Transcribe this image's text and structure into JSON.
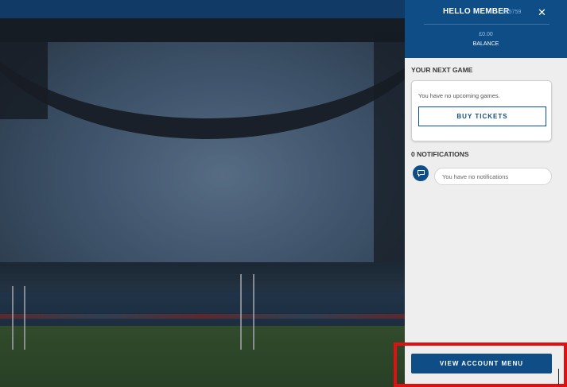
{
  "panel": {
    "greeting": "HELLO MEMBER",
    "member_id": "925759",
    "close_glyph": "✕",
    "balance_amount": "£0.00",
    "balance_label": "BALANCE",
    "next_game_title": "YOUR NEXT GAME",
    "no_games_text": "You have no upcoming games.",
    "buy_tickets_label": "BUY TICKETS",
    "notifications_title": "0 NOTIFICATIONS",
    "no_notifications_text": "You have no notifications",
    "view_account_label": "VIEW ACCOUNT MENU"
  },
  "colors": {
    "brand_blue": "#0e4d86",
    "highlight_red": "#e01010",
    "panel_bg": "#eeeeee"
  },
  "icons": {
    "close": "close-icon",
    "notification": "chat-bubble-icon"
  }
}
